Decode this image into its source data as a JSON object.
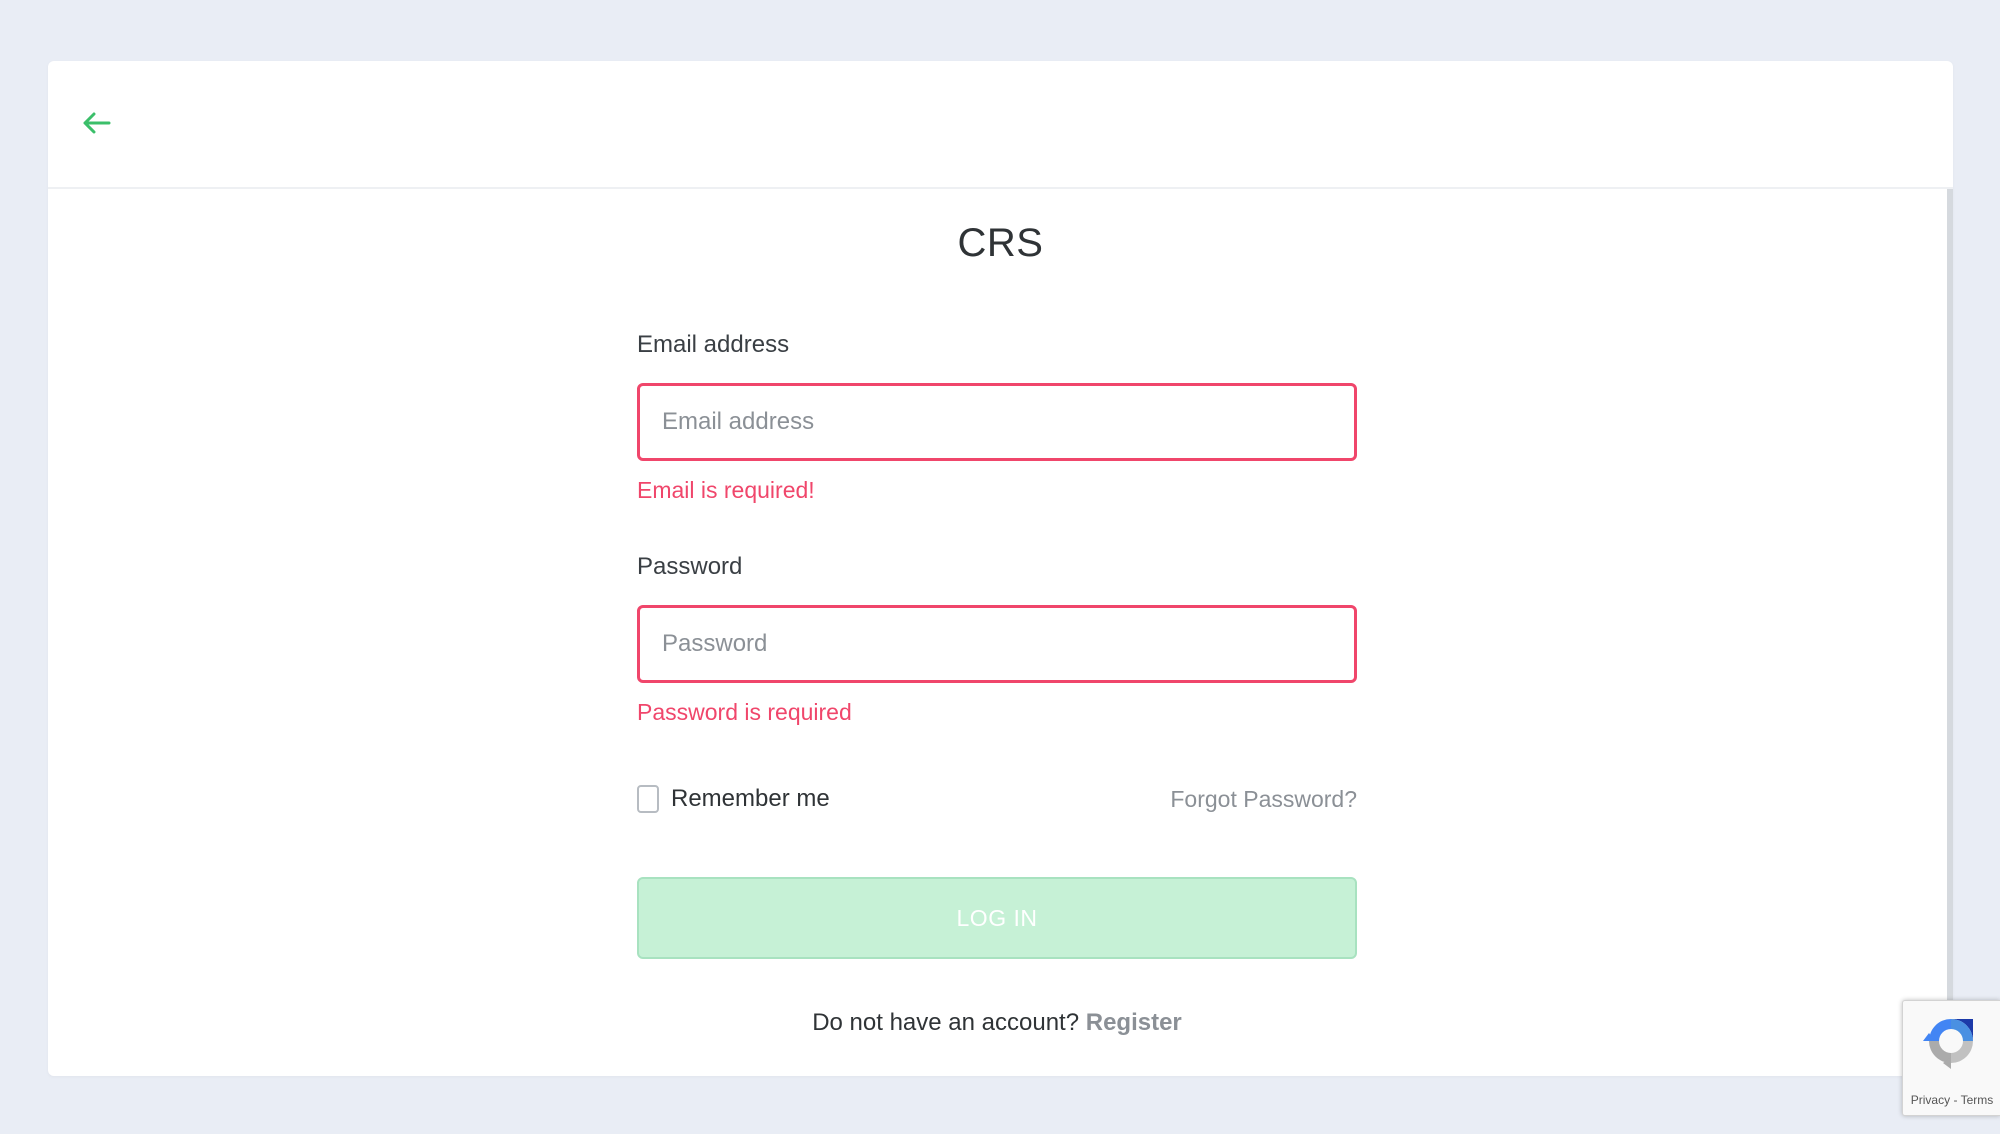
{
  "header": {
    "back_icon": "arrow-left-icon",
    "accent_color": "#3bbf6a"
  },
  "page": {
    "title": "CRS"
  },
  "form": {
    "email_label": "Email address",
    "email_placeholder": "Email address",
    "email_value": "",
    "email_error": "Email is required!",
    "password_label": "Password",
    "password_placeholder": "Password",
    "password_value": "",
    "password_error": "Password is required",
    "remember_label": "Remember me",
    "remember_checked": false,
    "forgot_link": "Forgot Password?",
    "login_button": "LOG IN",
    "register_prompt": "Do not have an account?",
    "register_link": "Register",
    "error_color": "#f0466b",
    "button_color": "#c6f1d6"
  },
  "recaptcha": {
    "icon": "recaptcha-icon",
    "privacy_label": "Privacy",
    "separator": "-",
    "terms_label": "Terms"
  }
}
